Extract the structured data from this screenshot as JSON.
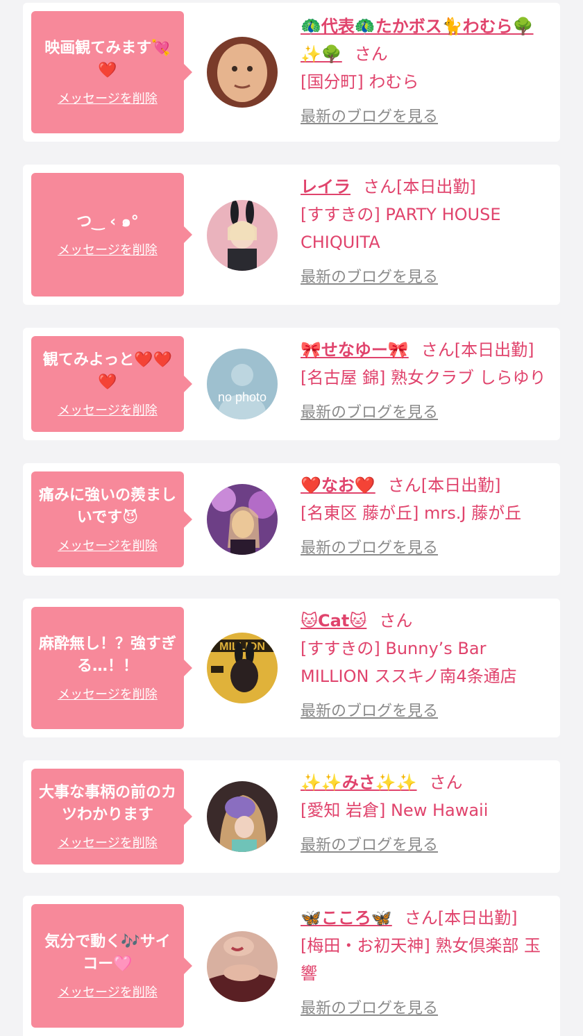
{
  "labels": {
    "delete": "メッセージを削除",
    "blog": "最新のブログを見る",
    "san": "さん"
  },
  "items": [
    {
      "message": "映画観てみます💘❤️",
      "name": "🦚代表🦚たかボス🐈わむら🌳✨🌳",
      "status": "",
      "shop": "[国分町] わむら",
      "avatar_color": "#6e4b3a"
    },
    {
      "message": "つ‿ ‹ ๑°",
      "name": "レイラ",
      "status": "[本日出勤]",
      "shop": "[すすきの] PARTY HOUSE CHIQUITA",
      "avatar_color": "#e8a8b4"
    },
    {
      "message": "観てみよっと❤️❤️❤️",
      "name": "🎀せなゆー🎀",
      "status": "[本日出勤]",
      "shop": "[名古屋 錦] 熟女クラブ しらゆり",
      "avatar_color": "#8fb3c4"
    },
    {
      "message": "痛みに強いの羨ましいです😈",
      "name": "❤️なお❤️",
      "status": "[本日出勤]",
      "shop": "[名東区 藤が丘] mrs.J 藤が丘",
      "avatar_color": "#a25fa8"
    },
    {
      "message": "麻酔無し！？強すぎる…！！",
      "name": "🐱Cat🐱",
      "status": "",
      "shop": "[すすきの] Bunny’s Bar MILLION ススキノ南4条通店",
      "avatar_color": "#d9a62a"
    },
    {
      "message": "大事な事柄の前のカツわかります",
      "name": "✨✨みさ✨✨",
      "status": "",
      "shop": "[愛知 岩倉] New Hawaii",
      "avatar_color": "#8a6ec0"
    },
    {
      "message": "気分で動く🎶サイコー🩷",
      "name": "🦋こころ🦋",
      "status": "[本日出勤]",
      "shop": "[梅田・お初天神] 熟女倶楽部 玉響",
      "avatar_color": "#6b3a32"
    }
  ]
}
